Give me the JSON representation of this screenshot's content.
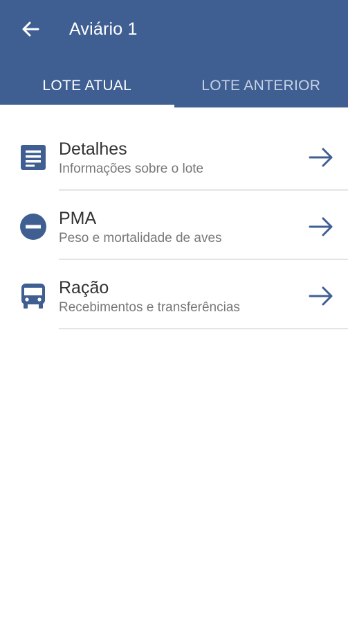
{
  "colors": {
    "primary": "#3f5f93",
    "icon": "#3f5f93",
    "white": "#ffffff"
  },
  "header": {
    "back_icon": "arrow-left-icon",
    "title": "Aviário 1"
  },
  "tabs": [
    {
      "label": "LOTE ATUAL",
      "active": true
    },
    {
      "label": "LOTE ANTERIOR",
      "active": false
    }
  ],
  "items": [
    {
      "icon": "document-icon",
      "title": "Detalhes",
      "subtitle": "Informações sobre o lote",
      "trailing_icon": "arrow-right-icon"
    },
    {
      "icon": "minus-circle-icon",
      "title": "PMA",
      "subtitle": "Peso e mortalidade de aves",
      "trailing_icon": "arrow-right-icon"
    },
    {
      "icon": "bus-icon",
      "title": "Ração",
      "subtitle": "Recebimentos e transferências",
      "trailing_icon": "arrow-right-icon"
    }
  ]
}
